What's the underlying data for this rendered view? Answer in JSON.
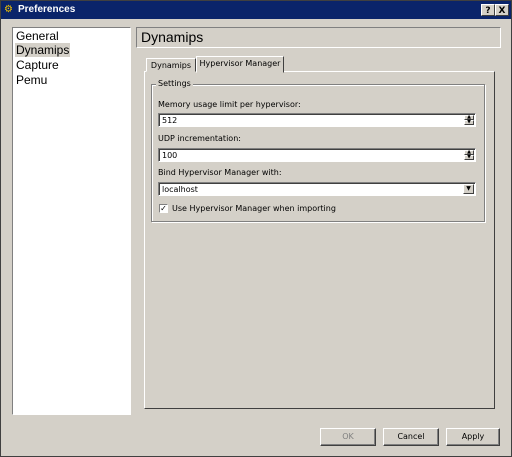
{
  "window": {
    "title": "Preferences",
    "help_label": "?",
    "close_label": "X"
  },
  "sidebar": {
    "items": [
      {
        "label": "General"
      },
      {
        "label": "Dynamips"
      },
      {
        "label": "Capture"
      },
      {
        "label": "Pemu"
      }
    ],
    "selected": "Dynamips"
  },
  "header": {
    "title": "Dynamips"
  },
  "tabs": [
    {
      "label": "Dynamips"
    },
    {
      "label": "Hypervisor Manager"
    }
  ],
  "active_tab": "Hypervisor Manager",
  "settings": {
    "group_title": "Settings",
    "memory_label": "Memory usage limit per hypervisor:",
    "memory_value": "512",
    "udp_label": "UDP incrementation:",
    "udp_value": "100",
    "bind_label": "Bind Hypervisor Manager with:",
    "bind_value": "localhost",
    "use_hm_label": "Use Hypervisor Manager when importing",
    "use_hm_checked": true,
    "check_mark": "✓"
  },
  "buttons": {
    "ok": "OK",
    "cancel": "Cancel",
    "apply": "Apply"
  },
  "colors": {
    "titlebar": "#0a246a",
    "window": "#d4d0c8"
  }
}
